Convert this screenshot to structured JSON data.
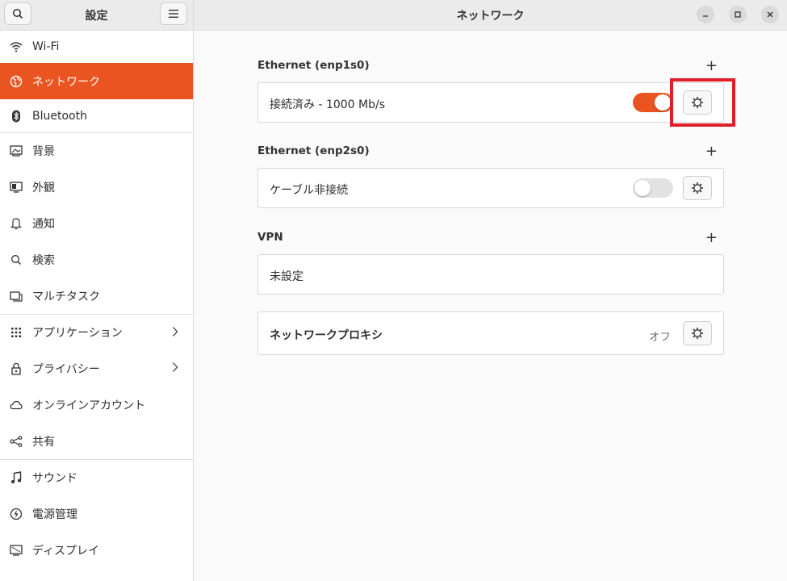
{
  "sidebar": {
    "title": "設定",
    "items": [
      {
        "label": "Wi-Fi",
        "icon": "wifi-icon"
      },
      {
        "label": "ネットワーク",
        "icon": "network-icon",
        "active": true
      },
      {
        "label": "Bluetooth",
        "icon": "bluetooth-icon"
      },
      {
        "label": "背景",
        "icon": "background-icon"
      },
      {
        "label": "外観",
        "icon": "appearance-icon"
      },
      {
        "label": "通知",
        "icon": "bell-icon"
      },
      {
        "label": "検索",
        "icon": "search-icon"
      },
      {
        "label": "マルチタスク",
        "icon": "multitask-icon"
      },
      {
        "label": "アプリケーション",
        "icon": "apps-icon"
      },
      {
        "label": "プライバシー",
        "icon": "lock-icon"
      },
      {
        "label": "オンラインアカウント",
        "icon": "cloud-icon"
      },
      {
        "label": "共有",
        "icon": "share-icon"
      },
      {
        "label": "サウンド",
        "icon": "music-note-icon"
      },
      {
        "label": "電源管理",
        "icon": "power-icon"
      },
      {
        "label": "ディスプレイ",
        "icon": "display-icon"
      }
    ]
  },
  "window": {
    "title": "ネットワーク"
  },
  "ethernet1": {
    "title": "Ethernet (enp1s0)",
    "status": "接続済み - 1000 Mb/s",
    "enabled": true
  },
  "ethernet2": {
    "title": "Ethernet (enp2s0)",
    "status": "ケーブル非接続",
    "enabled": false
  },
  "vpn": {
    "title": "VPN",
    "status": "未設定"
  },
  "proxy": {
    "label": "ネットワークプロキシ",
    "value": "オフ"
  },
  "colors": {
    "accent": "#e95420",
    "highlight": "#e01e2a"
  }
}
